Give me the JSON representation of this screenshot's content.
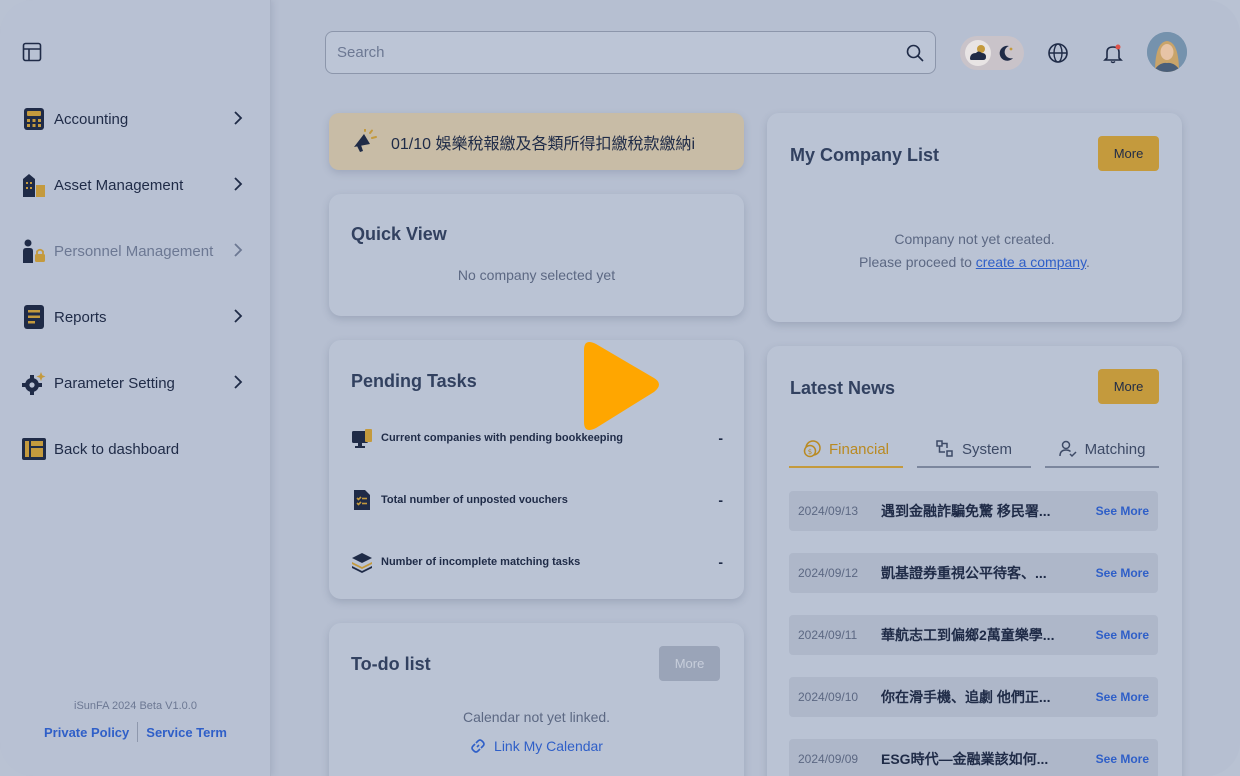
{
  "sidebar": {
    "items": [
      {
        "label": "Accounting"
      },
      {
        "label": "Asset Management"
      },
      {
        "label": "Personnel Management"
      },
      {
        "label": "Reports"
      },
      {
        "label": "Parameter Setting"
      },
      {
        "label": "Back to dashboard"
      }
    ],
    "version": "iSunFA 2024 Beta V1.0.0",
    "private_policy": "Private Policy",
    "service_term": "Service Term"
  },
  "topbar": {
    "search_placeholder": "Search"
  },
  "announcement": {
    "text": "01/10 娛樂稅報繳及各類所得扣繳稅款繳納i"
  },
  "quick_view": {
    "title": "Quick View",
    "empty": "No company selected yet"
  },
  "pending_tasks": {
    "title": "Pending Tasks",
    "items": [
      {
        "label": "Current companies with pending bookkeeping",
        "value": "-"
      },
      {
        "label": "Total number of unposted vouchers",
        "value": "-"
      },
      {
        "label": "Number of incomplete matching tasks",
        "value": "-"
      }
    ]
  },
  "todo": {
    "title": "To-do list",
    "more": "More",
    "empty": "Calendar not yet linked.",
    "link": "Link My Calendar"
  },
  "company_list": {
    "title": "My Company List",
    "more": "More",
    "line1": "Company not yet created.",
    "line2_prefix": "Please proceed to ",
    "line2_link": "create a company",
    "line2_suffix": "."
  },
  "latest_news": {
    "title": "Latest News",
    "more": "More",
    "tabs": [
      {
        "label": "Financial"
      },
      {
        "label": "System"
      },
      {
        "label": "Matching"
      }
    ],
    "items": [
      {
        "date": "2024/09/13",
        "title": "遇到金融詐騙免驚 移民署...",
        "more": "See More"
      },
      {
        "date": "2024/09/12",
        "title": "凱基證券重視公平待客、...",
        "more": "See More"
      },
      {
        "date": "2024/09/11",
        "title": "華航志工到偏鄉2萬童樂學...",
        "more": "See More"
      },
      {
        "date": "2024/09/10",
        "title": "你在滑手機、追劇 他們正...",
        "more": "See More"
      },
      {
        "date": "2024/09/09",
        "title": "ESG時代—金融業該如何...",
        "more": "See More"
      }
    ]
  },
  "colors": {
    "accent": "#c49a3d",
    "link": "#2f5fc8",
    "navy": "#1f2b47",
    "play": "#ffa600"
  }
}
